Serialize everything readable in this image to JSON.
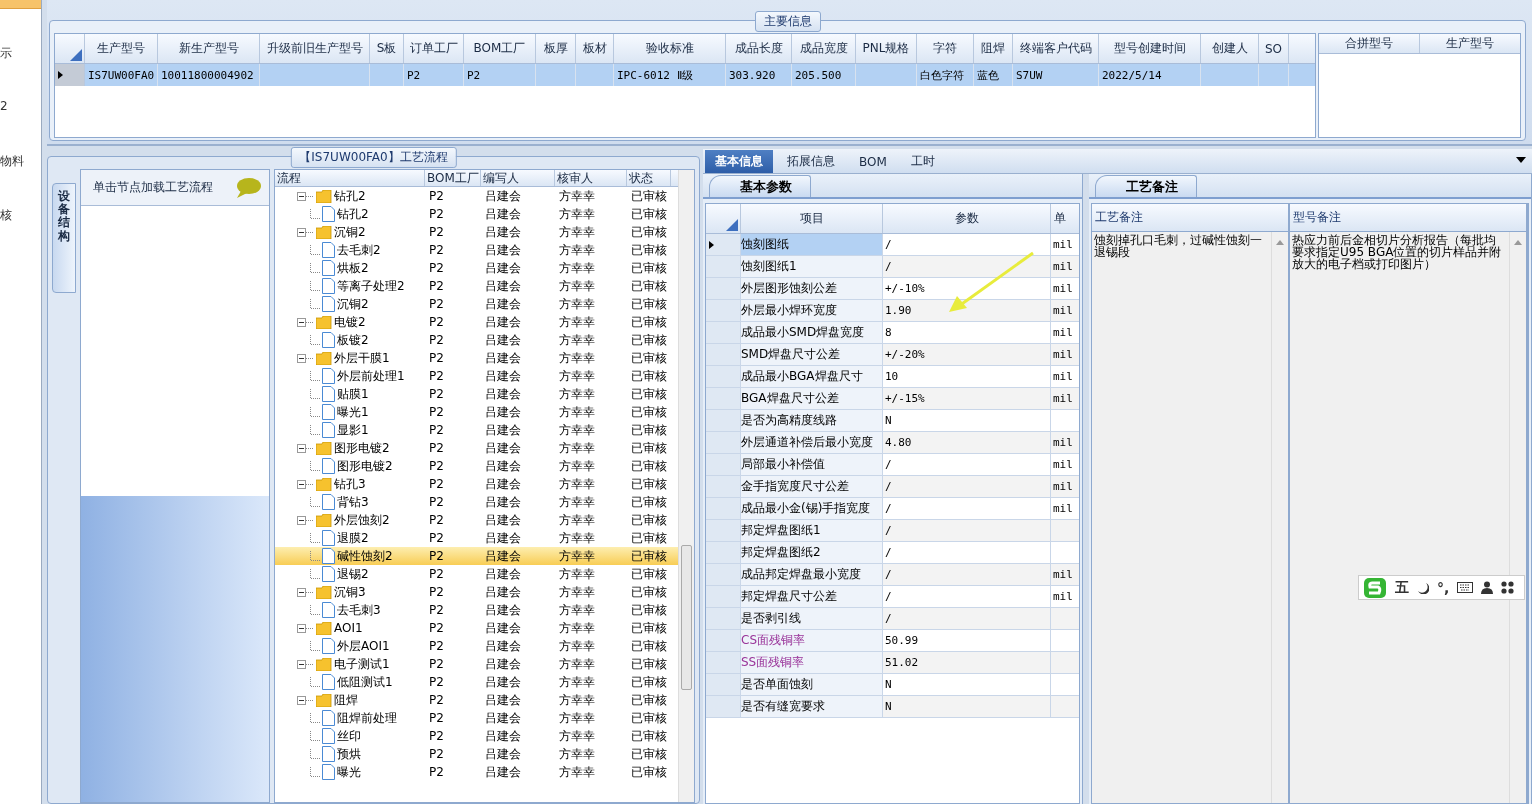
{
  "nav": {
    "items": [
      "示",
      "2",
      "物料",
      "核"
    ]
  },
  "main_info": {
    "title": "主要信息",
    "columns": [
      "生产型号",
      "新生产型号",
      "升级前旧生产型号",
      "S板",
      "订单工厂",
      "BOM工厂",
      "板厚",
      "板材",
      "验收标准",
      "成品长度",
      "成品宽度",
      "PNL规格",
      "字符",
      "阻焊",
      "终端客户代码",
      "型号创建时间",
      "创建人",
      "SO"
    ],
    "rows": [
      {
        "selected": true,
        "cells": [
          "IS7UW00FA0",
          "10011800004902",
          null,
          null,
          "P2",
          "P2",
          null,
          null,
          "IPC-6012 Ⅱ级",
          "303.920",
          "205.500",
          null,
          "白色字符",
          "蓝色",
          "S7UW",
          "2022/5/14",
          null,
          null
        ]
      }
    ]
  },
  "merge_table": {
    "columns": [
      "合拼型号",
      "生产型号"
    ]
  },
  "process_flow": {
    "title": "【IS7UW00FA0】工艺流程",
    "side_tab": "设备结构",
    "hint": "单击节点加载工艺流程",
    "columns": [
      "流程",
      "BOM工厂",
      "编写人",
      "核审人",
      "状态"
    ],
    "nodes": [
      {
        "label": "钻孔2",
        "bom": "P2",
        "writer": "吕建会",
        "reviewer": "方幸幸",
        "status": "已审核",
        "selected": false,
        "expanded": true,
        "children": [
          {
            "label": "钻孔2",
            "bom": "P2",
            "writer": "吕建会",
            "reviewer": "方幸幸",
            "status": "已审核",
            "selected": false
          }
        ]
      },
      {
        "label": "沉铜2",
        "bom": "P2",
        "writer": "吕建会",
        "reviewer": "方幸幸",
        "status": "已审核",
        "selected": false,
        "expanded": true,
        "children": [
          {
            "label": "去毛刺2",
            "bom": "P2",
            "writer": "吕建会",
            "reviewer": "方幸幸",
            "status": "已审核",
            "selected": false
          },
          {
            "label": "烘板2",
            "bom": "P2",
            "writer": "吕建会",
            "reviewer": "方幸幸",
            "status": "已审核",
            "selected": false
          },
          {
            "label": "等离子处理2",
            "bom": "P2",
            "writer": "吕建会",
            "reviewer": "方幸幸",
            "status": "已审核",
            "selected": false
          },
          {
            "label": "沉铜2",
            "bom": "P2",
            "writer": "吕建会",
            "reviewer": "方幸幸",
            "status": "已审核",
            "selected": false
          }
        ]
      },
      {
        "label": "电镀2",
        "bom": "P2",
        "writer": "吕建会",
        "reviewer": "方幸幸",
        "status": "已审核",
        "selected": false,
        "expanded": true,
        "children": [
          {
            "label": "板镀2",
            "bom": "P2",
            "writer": "吕建会",
            "reviewer": "方幸幸",
            "status": "已审核",
            "selected": false
          }
        ]
      },
      {
        "label": "外层干膜1",
        "bom": "P2",
        "writer": "吕建会",
        "reviewer": "方幸幸",
        "status": "已审核",
        "selected": false,
        "expanded": true,
        "children": [
          {
            "label": "外层前处理1",
            "bom": "P2",
            "writer": "吕建会",
            "reviewer": "方幸幸",
            "status": "已审核",
            "selected": false
          },
          {
            "label": "贴膜1",
            "bom": "P2",
            "writer": "吕建会",
            "reviewer": "方幸幸",
            "status": "已审核",
            "selected": false
          },
          {
            "label": "曝光1",
            "bom": "P2",
            "writer": "吕建会",
            "reviewer": "方幸幸",
            "status": "已审核",
            "selected": false
          },
          {
            "label": "显影1",
            "bom": "P2",
            "writer": "吕建会",
            "reviewer": "方幸幸",
            "status": "已审核",
            "selected": false
          }
        ]
      },
      {
        "label": "图形电镀2",
        "bom": "P2",
        "writer": "吕建会",
        "reviewer": "方幸幸",
        "status": "已审核",
        "selected": false,
        "expanded": true,
        "children": [
          {
            "label": "图形电镀2",
            "bom": "P2",
            "writer": "吕建会",
            "reviewer": "方幸幸",
            "status": "已审核",
            "selected": false
          }
        ]
      },
      {
        "label": "钻孔3",
        "bom": "P2",
        "writer": "吕建会",
        "reviewer": "方幸幸",
        "status": "已审核",
        "selected": false,
        "expanded": true,
        "children": [
          {
            "label": "背钻3",
            "bom": "P2",
            "writer": "吕建会",
            "reviewer": "方幸幸",
            "status": "已审核",
            "selected": false
          }
        ]
      },
      {
        "label": "外层蚀刻2",
        "bom": "P2",
        "writer": "吕建会",
        "reviewer": "方幸幸",
        "status": "已审核",
        "selected": false,
        "expanded": true,
        "children": [
          {
            "label": "退膜2",
            "bom": "P2",
            "writer": "吕建会",
            "reviewer": "方幸幸",
            "status": "已审核",
            "selected": false
          },
          {
            "label": "碱性蚀刻2",
            "bom": "P2",
            "writer": "吕建会",
            "reviewer": "方幸幸",
            "status": "已审核",
            "selected": true
          },
          {
            "label": "退锡2",
            "bom": "P2",
            "writer": "吕建会",
            "reviewer": "方幸幸",
            "status": "已审核",
            "selected": false
          }
        ]
      },
      {
        "label": "沉铜3",
        "bom": "P2",
        "writer": "吕建会",
        "reviewer": "方幸幸",
        "status": "已审核",
        "selected": false,
        "expanded": true,
        "children": [
          {
            "label": "去毛刺3",
            "bom": "P2",
            "writer": "吕建会",
            "reviewer": "方幸幸",
            "status": "已审核",
            "selected": false
          }
        ]
      },
      {
        "label": "AOI1",
        "bom": "P2",
        "writer": "吕建会",
        "reviewer": "方幸幸",
        "status": "已审核",
        "selected": false,
        "expanded": true,
        "children": [
          {
            "label": "外层AOI1",
            "bom": "P2",
            "writer": "吕建会",
            "reviewer": "方幸幸",
            "status": "已审核",
            "selected": false
          }
        ]
      },
      {
        "label": "电子测试1",
        "bom": "P2",
        "writer": "吕建会",
        "reviewer": "方幸幸",
        "status": "已审核",
        "selected": false,
        "expanded": true,
        "children": [
          {
            "label": "低阻测试1",
            "bom": "P2",
            "writer": "吕建会",
            "reviewer": "方幸幸",
            "status": "已审核",
            "selected": false
          }
        ]
      },
      {
        "label": "阻焊",
        "bom": "P2",
        "writer": "吕建会",
        "reviewer": "方幸幸",
        "status": "已审核",
        "selected": false,
        "expanded": true,
        "children": [
          {
            "label": "阻焊前处理",
            "bom": "P2",
            "writer": "吕建会",
            "reviewer": "方幸幸",
            "status": "已审核",
            "selected": false
          },
          {
            "label": "丝印",
            "bom": "P2",
            "writer": "吕建会",
            "reviewer": "方幸幸",
            "status": "已审核",
            "selected": false
          },
          {
            "label": "预烘",
            "bom": "P2",
            "writer": "吕建会",
            "reviewer": "方幸幸",
            "status": "已审核",
            "selected": false
          },
          {
            "label": "曝光",
            "bom": "P2",
            "writer": "吕建会",
            "reviewer": "方幸幸",
            "status": "已审核",
            "selected": false
          }
        ]
      }
    ]
  },
  "detail_tabs": [
    {
      "label": "基本信息",
      "selected": true
    },
    {
      "label": "拓展信息",
      "selected": false
    },
    {
      "label": "BOM",
      "selected": false
    },
    {
      "label": "工时",
      "selected": false
    }
  ],
  "basic_params": {
    "title": "基本参数",
    "columns": [
      "项目",
      "参数",
      "单"
    ],
    "rows": [
      {
        "item": "蚀刻图纸",
        "value": "/",
        "unit": "mil",
        "selected": true,
        "kind": "plain"
      },
      {
        "item": "蚀刻图纸1",
        "value": "/",
        "unit": "mil",
        "selected": false,
        "kind": "plain"
      },
      {
        "item": "外层图形蚀刻公差",
        "value": "+/-10%",
        "unit": "mil",
        "selected": false,
        "kind": "plain"
      },
      {
        "item": "外层最小焊环宽度",
        "value": "1.90",
        "unit": "mil",
        "selected": false,
        "kind": "plain"
      },
      {
        "item": "成品最小SMD焊盘宽度",
        "value": "8",
        "unit": "mil",
        "selected": false,
        "kind": "plain"
      },
      {
        "item": "SMD焊盘尺寸公差",
        "value": "+/-20%",
        "unit": "mil",
        "selected": false,
        "kind": "plain"
      },
      {
        "item": "成品最小BGA焊盘尺寸",
        "value": "10",
        "unit": "mil",
        "selected": false,
        "kind": "plain"
      },
      {
        "item": "BGA焊盘尺寸公差",
        "value": "+/-15%",
        "unit": "mil",
        "selected": false,
        "kind": "plain"
      },
      {
        "item": "是否为高精度线路",
        "value": "N",
        "unit": null,
        "selected": false,
        "kind": "plain"
      },
      {
        "item": "外层通道补偿后最小宽度",
        "value": "4.80",
        "unit": "mil",
        "selected": false,
        "kind": "plain"
      },
      {
        "item": "局部最小补偿值",
        "value": "/",
        "unit": "mil",
        "selected": false,
        "kind": "plain"
      },
      {
        "item": "金手指宽度尺寸公差",
        "value": "/",
        "unit": "mil",
        "selected": false,
        "kind": "plain"
      },
      {
        "item": "成品最小金(锡)手指宽度",
        "value": "/",
        "unit": "mil",
        "selected": false,
        "kind": "plain"
      },
      {
        "item": "邦定焊盘图纸1",
        "value": "/",
        "unit": null,
        "selected": false,
        "kind": "plain"
      },
      {
        "item": "邦定焊盘图纸2",
        "value": "/",
        "unit": null,
        "selected": false,
        "kind": "plain"
      },
      {
        "item": "成品邦定焊盘最小宽度",
        "value": "/",
        "unit": "mil",
        "selected": false,
        "kind": "plain"
      },
      {
        "item": "邦定焊盘尺寸公差",
        "value": "/",
        "unit": "mil",
        "selected": false,
        "kind": "plain"
      },
      {
        "item": "是否剥引线",
        "value": "/",
        "unit": null,
        "selected": false,
        "kind": "plain"
      },
      {
        "item": "CS面残铜率",
        "value": "50.99",
        "unit": null,
        "selected": false,
        "kind": "ratio"
      },
      {
        "item": "SS面残铜率",
        "value": "51.02",
        "unit": null,
        "selected": false,
        "kind": "ratio"
      },
      {
        "item": "是否单面蚀刻",
        "value": "N",
        "unit": null,
        "selected": false,
        "kind": "plain"
      },
      {
        "item": "是否有缝宽要求",
        "value": "N",
        "unit": null,
        "selected": false,
        "kind": "plain"
      }
    ]
  },
  "notes": {
    "title": "工艺备注",
    "columns": [
      "工艺备注",
      "型号备注"
    ],
    "values": [
      "蚀刻掉孔口毛刺，过碱性蚀刻一退锡段",
      "热应力前后金相切片分析报告（每批均要求指定U95 BGA位置的切片样品并附放大的电子档或打印图片）"
    ]
  },
  "ime": {
    "items": [
      "五",
      "°,"
    ]
  }
}
